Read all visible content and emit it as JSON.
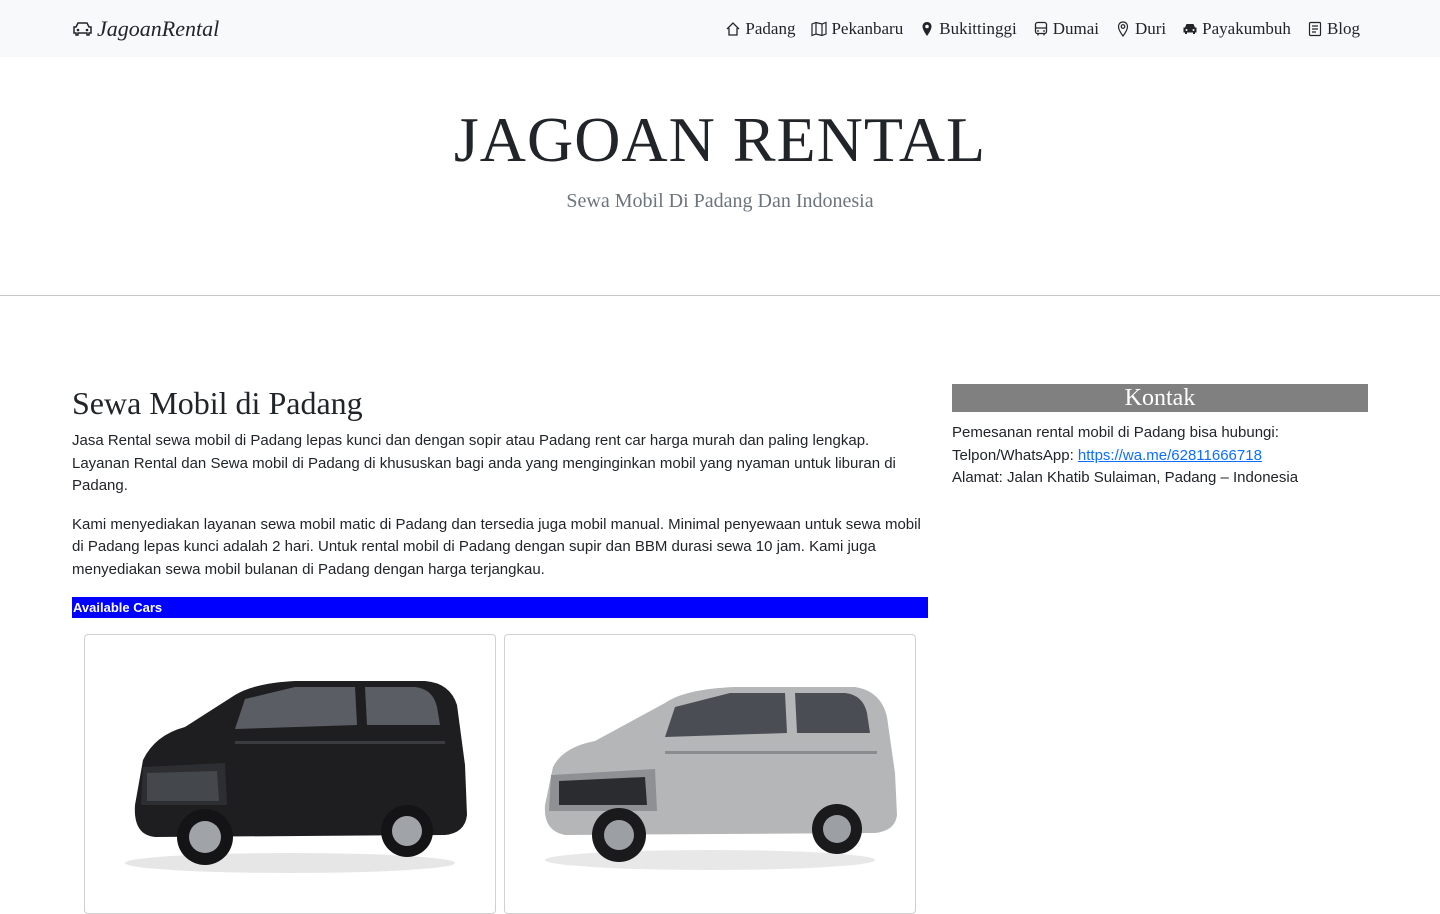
{
  "navbar": {
    "brand": "JagoanRental",
    "brand_icon": "car-icon",
    "items": [
      {
        "label": "Padang",
        "icon": "house-icon"
      },
      {
        "label": "Pekanbaru",
        "icon": "map-icon"
      },
      {
        "label": "Bukittinggi",
        "icon": "geo-pin-filled-icon"
      },
      {
        "label": "Dumai",
        "icon": "bus-icon"
      },
      {
        "label": "Duri",
        "icon": "geo-pin-icon"
      },
      {
        "label": "Payakumbuh",
        "icon": "car-icon"
      },
      {
        "label": "Blog",
        "icon": "document-icon"
      }
    ]
  },
  "hero": {
    "title": "JAGOAN RENTAL",
    "subtitle": "Sewa Mobil Di Padang Dan Indonesia"
  },
  "main": {
    "heading": "Sewa Mobil di Padang",
    "paragraphs": [
      "Jasa Rental sewa mobil di Padang lepas kunci dan dengan sopir atau Padang rent car harga murah dan paling lengkap. Layanan Rental dan Sewa mobil di Padang di khususkan bagi anda yang menginginkan mobil yang nyaman untuk liburan di Padang.",
      "Kami menyediakan layanan sewa mobil matic di Padang dan tersedia juga mobil manual. Minimal penyewaan untuk sewa mobil di Padang lepas kunci adalah 2 hari. Untuk rental mobil di Padang dengan supir dan BBM durasi sewa 10 jam. Kami juga menyediakan sewa mobil bulanan di Padang dengan harga terjangkau."
    ],
    "available_label": "Available Cars",
    "cars": [
      {
        "image": "black-toyota-innova-image",
        "color": "#1e1e20"
      },
      {
        "image": "silver-toyota-avanza-image",
        "color": "#b4b6b8"
      }
    ]
  },
  "sidebar": {
    "heading": "Kontak",
    "line1": "Pemesanan rental mobil di Padang bisa hubungi:",
    "phone_label": "Telpon/WhatsApp: ",
    "phone_link": "https://wa.me/62811666718",
    "address": "Alamat: Jalan Khatib Sulaiman, Padang – Indonesia"
  },
  "colors": {
    "navbar_bg": "#f8f9fa",
    "available_bar": "#0000ff",
    "sidebar_head": "#808080",
    "link": "#0d6efd"
  }
}
